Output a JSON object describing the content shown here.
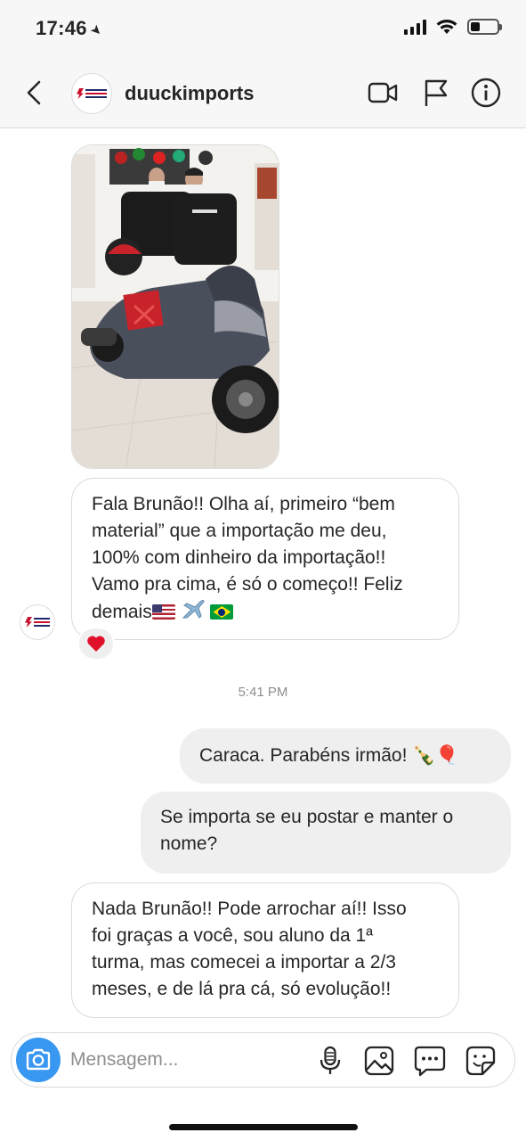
{
  "status_bar": {
    "time": "17:46",
    "battery_percent": 35
  },
  "header": {
    "username": "duuckimports",
    "icons": [
      "chevron-left-icon",
      "video-camera-icon",
      "flag-icon",
      "info-icon"
    ]
  },
  "thread": {
    "messages": [
      {
        "direction": "incoming",
        "type": "photo"
      },
      {
        "direction": "incoming",
        "type": "text",
        "line1": "Fala Brunão!! Olha aí, primeiro “bem",
        "line2": "material” que a importação me deu,",
        "line3": "100% com dinheiro da importação!!",
        "line4": "Vamo pra cima, é só o começo!! Feliz",
        "line5": "demais",
        "emojis": [
          "flag-us-icon",
          "airplane-icon",
          "flag-br-icon"
        ],
        "reaction": "❤️"
      },
      {
        "direction": "outgoing",
        "type": "text",
        "text": "Caraca. Parabéns irmão! 🍾🎈"
      },
      {
        "direction": "outgoing",
        "type": "text",
        "line1": "Se importa se eu postar e manter o",
        "line2": "nome?"
      },
      {
        "direction": "incoming",
        "type": "text",
        "line1": "Nada Brunão!! Pode arrochar aí!! Isso",
        "line2": "foi graças a você, sou aluno da 1ª",
        "line3": "turma, mas comecei a importar a 2/3",
        "line4": "meses, e de lá pra cá, só evolução!!"
      }
    ],
    "timestamp": "5:41 PM"
  },
  "composer": {
    "placeholder": "Mensagem...",
    "icons": [
      "camera-icon",
      "microphone-icon",
      "gallery-icon",
      "more-icon",
      "sticker-icon"
    ]
  },
  "colors": {
    "accent": "#3897f0",
    "bubble_outgoing": "#efefef",
    "border": "#dbdbdb",
    "brand_red": "#c8102e",
    "brand_navy": "#1f2a6b"
  }
}
